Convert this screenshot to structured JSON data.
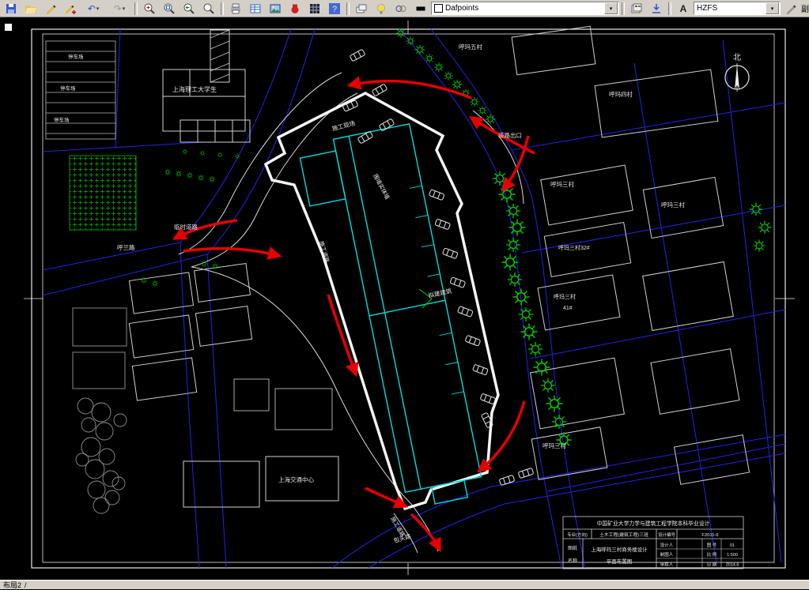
{
  "toolbar": {
    "glyphs": {
      "undo": "↶",
      "redo": "↷",
      "caret": "▾",
      "help": "?",
      "text_style": "A"
    },
    "layer_combo_value": "Dafpoints",
    "style_combo_value": "HZFS",
    "copy_label": "副本"
  },
  "statusbar": {
    "layout_tab": "布局2",
    "divider": "/"
  },
  "drawing": {
    "north_label": "北",
    "labels": [
      {
        "text": "停车场"
      },
      {
        "text": "停车场"
      },
      {
        "text": "停车场"
      },
      {
        "text": "上海理工大学生"
      },
      {
        "text": "呼玛五村"
      },
      {
        "text": "呼玛四村"
      },
      {
        "text": "道路出口"
      },
      {
        "text": "施工现场"
      },
      {
        "text": "围墙实体墙"
      },
      {
        "text": "呼玛三村"
      },
      {
        "text": "呼玛三村"
      },
      {
        "text": "呼玛三村32#"
      },
      {
        "text": "呼玛三村"
      },
      {
        "text": "41#"
      },
      {
        "text": "临时道路"
      },
      {
        "text": "呼兰路"
      },
      {
        "text": "施工道路"
      },
      {
        "text": "拟建建筑"
      },
      {
        "text": "呼玛三村"
      },
      {
        "text": "上海交通中心"
      },
      {
        "text": "包头路"
      },
      {
        "text": "施工道路"
      }
    ],
    "title_block": {
      "header": "中国矿业大学力学与建筑工程学院本科毕业设计",
      "major_label": "专业(方向)",
      "major_value": "土木工程(建筑工程)三班",
      "code_label": "设计编号",
      "code_value": "F2011-6",
      "sheet_label_1": "图纸",
      "sheet_label_2": "名称",
      "project_name": "上海呼玛三村商务楼设计",
      "sheet_name": "平面布置图",
      "designer_label": "设计人",
      "drafter_label": "制图人",
      "checker_label": "审核人",
      "no_label": "图 号",
      "scale_label": "比 例",
      "date_label": "日 期",
      "no_value": "01",
      "scale_value": "1:500",
      "date_value": "2014.6"
    }
  }
}
